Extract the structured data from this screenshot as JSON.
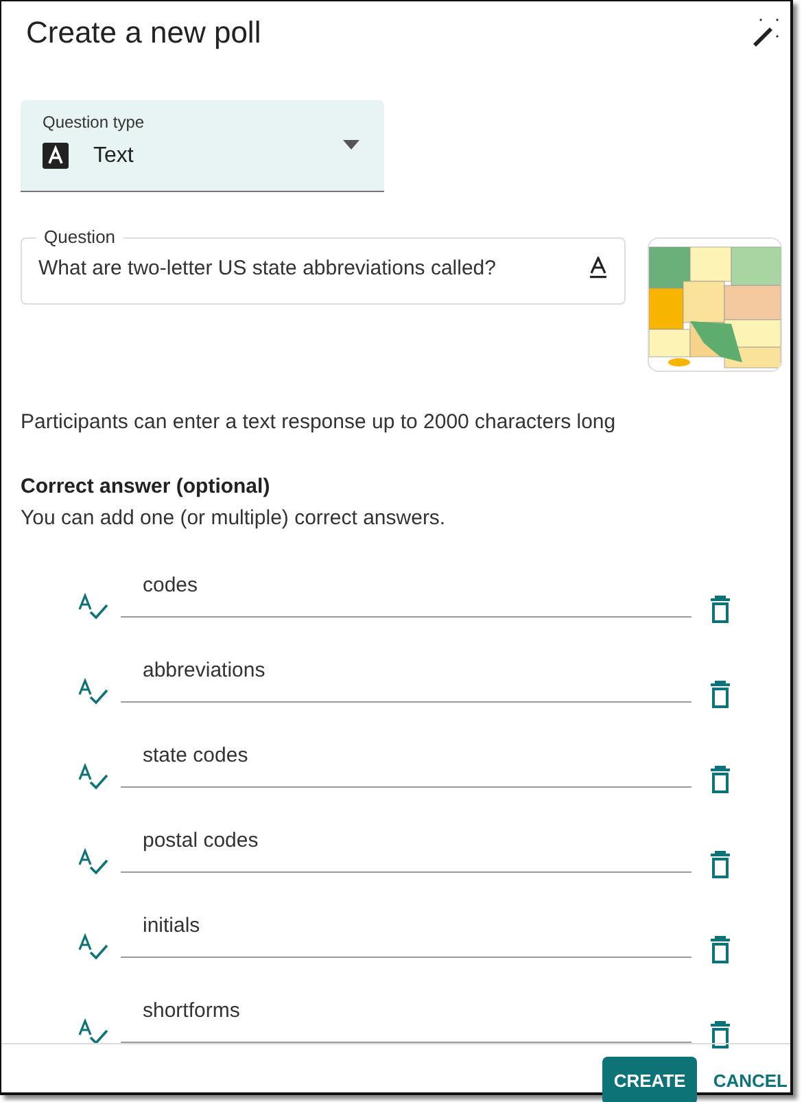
{
  "dialog": {
    "title": "Create a new poll"
  },
  "question_type": {
    "label": "Question type",
    "value": "Text"
  },
  "question": {
    "label": "Question",
    "value": "What are two-letter US state abbreviations called?"
  },
  "hint": "Participants can enter a text response up to 2000 characters long",
  "correct_answer": {
    "heading": "Correct answer (optional)",
    "subtitle": "You can add one (or multiple) correct answers."
  },
  "answers": [
    {
      "value": "codes"
    },
    {
      "value": "abbreviations"
    },
    {
      "value": "state codes"
    },
    {
      "value": "postal codes"
    },
    {
      "value": "initials"
    },
    {
      "value": "shortforms"
    }
  ],
  "buttons": [
    {
      "label": "CREATE",
      "kind": "primary"
    },
    {
      "label": "CANCEL",
      "kind": "text"
    }
  ]
}
